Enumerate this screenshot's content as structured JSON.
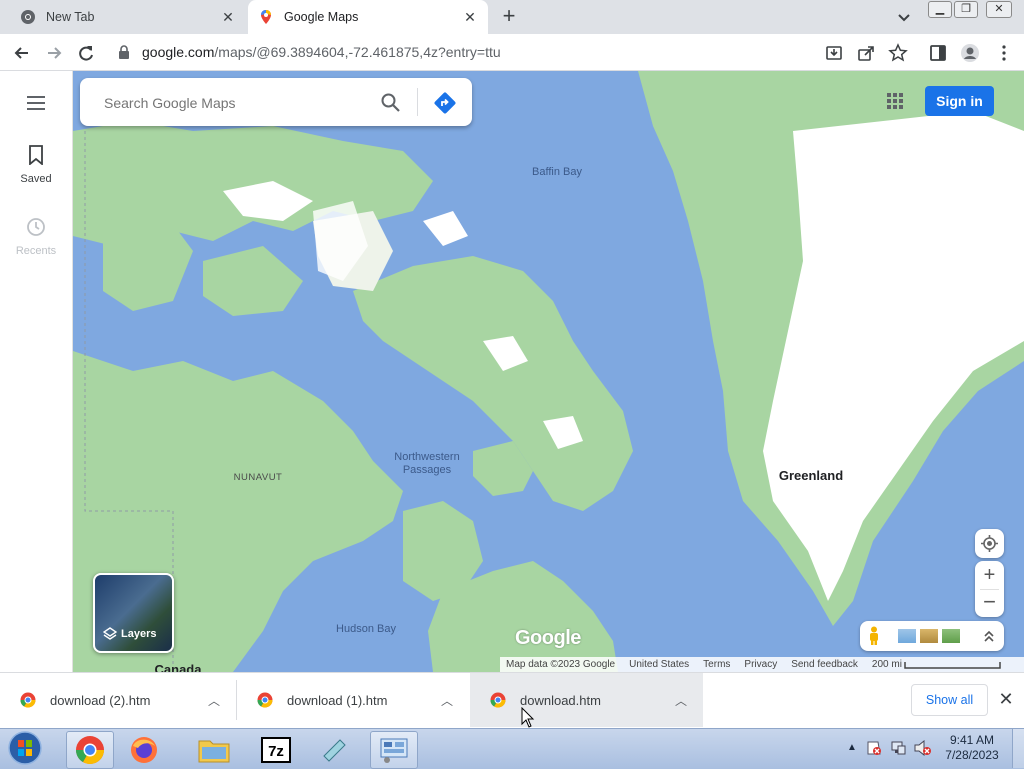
{
  "browser": {
    "tabs": [
      {
        "label": "New Tab",
        "icon": "chrome-icon"
      },
      {
        "label": "Google Maps",
        "icon": "maps-pin-icon",
        "active": true
      }
    ],
    "url_host": "google.com",
    "url_path": "/maps/@69.3894604,-72.461875,4z?entry=ttu"
  },
  "leftnav": {
    "saved_label": "Saved",
    "recents_label": "Recents"
  },
  "maps": {
    "search_placeholder": "Search Google Maps",
    "signin_label": "Sign in",
    "logo": "Google",
    "layers_label": "Layers",
    "labels": {
      "baffin_bay": "Baffin Bay",
      "nunavut": "NUNAVUT",
      "northwestern_passages_line1": "Northwestern",
      "northwestern_passages_line2": "Passages",
      "greenland": "Greenland",
      "hudson_bay": "Hudson Bay",
      "canada": "Canada"
    },
    "attribution": {
      "map_data": "Map data ©2023 Google",
      "region": "United States",
      "terms": "Terms",
      "privacy": "Privacy",
      "feedback": "Send feedback",
      "scale": "200 mi"
    },
    "colors": {
      "water": "#7fa8e0",
      "land": "#a8d5a2",
      "ice": "#ffffff",
      "accent": "#1a73e8"
    }
  },
  "downloads": {
    "items": [
      {
        "name": "download (2).htm"
      },
      {
        "name": "download (1).htm"
      },
      {
        "name": "download.htm"
      }
    ],
    "show_all_label": "Show all"
  },
  "taskbar": {
    "time": "9:41 AM",
    "date": "7/28/2023"
  }
}
